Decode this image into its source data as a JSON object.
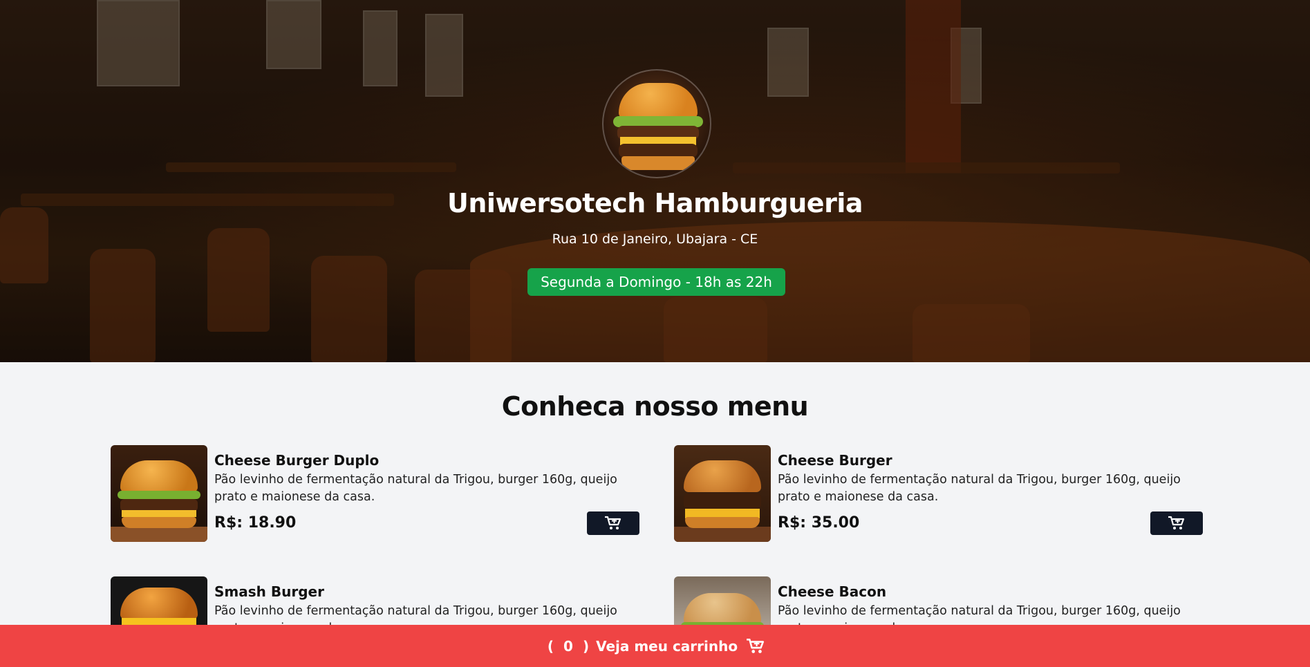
{
  "hero": {
    "title": "Uniwersotech Hamburgueria",
    "address": "Rua 10 de Janeiro, Ubajara - CE",
    "hours": "Segunda a Domingo - 18h as 22h",
    "hours_color": "#16a34a"
  },
  "menu": {
    "heading": "Conheca nosso menu",
    "items": [
      {
        "name": "Cheese Burger Duplo",
        "description": "Pão levinho de fermentação natural da Trigou, burger 160g, queijo prato e maionese da casa.",
        "price": "R$: 18.90",
        "add_icon": "cart-plus-icon"
      },
      {
        "name": "Cheese Burger",
        "description": "Pão levinho de fermentação natural da Trigou, burger 160g, queijo prato e maionese da casa.",
        "price": "R$: 35.00",
        "add_icon": "cart-plus-icon"
      },
      {
        "name": "Smash Burger",
        "description": "Pão levinho de fermentação natural da Trigou, burger 160g, queijo prato e maionese da casa.",
        "price": "",
        "add_icon": "cart-plus-icon"
      },
      {
        "name": "Cheese Bacon",
        "description": "Pão levinho de fermentação natural da Trigou, burger 160g, queijo prato e maionese da casa.",
        "price": "",
        "add_icon": "cart-plus-icon"
      }
    ]
  },
  "cart": {
    "open_paren": "(",
    "count": "0",
    "close_paren": ")",
    "label": "Veja meu carrinho",
    "icon": "cart-icon",
    "bar_color": "#ef4444"
  }
}
